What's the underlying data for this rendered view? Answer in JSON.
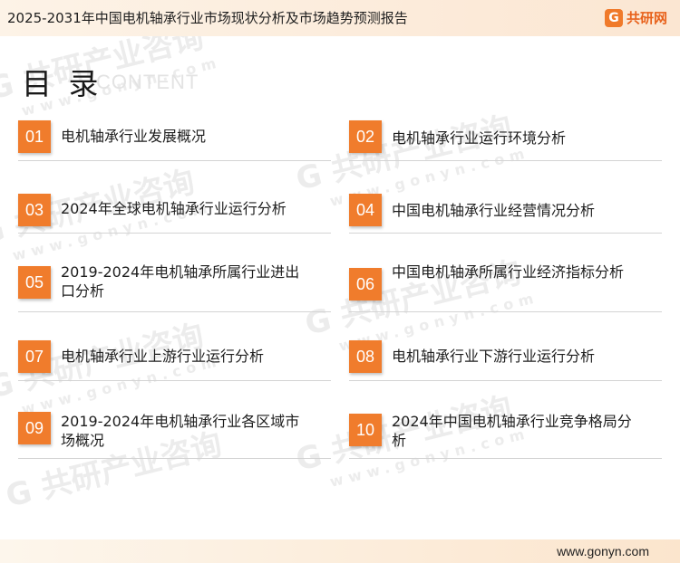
{
  "header": {
    "title": "2025-2031年中国电机轴承行业市场现状分析及市场趋势预测报告",
    "brand_icon": "G",
    "brand_name": "共研网"
  },
  "toc": {
    "heading": "目 录",
    "heading_en": "CONTENT",
    "items": [
      {
        "num": "01",
        "label": "电机轴承行业发展概况"
      },
      {
        "num": "02",
        "label": "电机轴承行业运行环境分析"
      },
      {
        "num": "03",
        "label": "2024年全球电机轴承行业运行分析"
      },
      {
        "num": "04",
        "label": "中国电机轴承行业经营情况分析"
      },
      {
        "num": "05",
        "label": "2019-2024年电机轴承所属行业进出口分析"
      },
      {
        "num": "06",
        "label": "中国电机轴承所属行业经济指标分析"
      },
      {
        "num": "07",
        "label": "电机轴承行业上游行业运行分析"
      },
      {
        "num": "08",
        "label": "电机轴承行业下游行业运行分析"
      },
      {
        "num": "09",
        "label": "2019-2024年电机轴承行业各区域市场概况"
      },
      {
        "num": "10",
        "label": "2024年中国电机轴承行业竞争格局分析"
      }
    ]
  },
  "watermark": {
    "text": "G 共研产业咨询",
    "url_text": "www.gonyn.com"
  },
  "footer": {
    "url": "www.gonyn.com"
  },
  "colors": {
    "accent": "#f07c2c",
    "brand": "#e8621c"
  }
}
